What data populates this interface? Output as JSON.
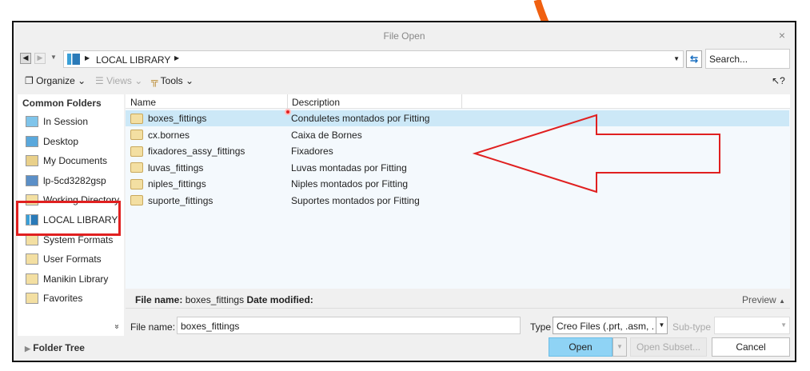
{
  "window": {
    "title": "File Open",
    "close": "×"
  },
  "address": {
    "path": "LOCAL LIBRARY",
    "search_placeholder": "Search..."
  },
  "toolbar": {
    "organize": "Organize",
    "views": "Views",
    "tools": "Tools",
    "help": "?"
  },
  "sidebar": {
    "heading": "Common Folders",
    "items": [
      {
        "label": "In Session"
      },
      {
        "label": "Desktop"
      },
      {
        "label": "My Documents"
      },
      {
        "label": "lp-5cd3282gsp"
      },
      {
        "label": "Working Directory"
      },
      {
        "label": "LOCAL LIBRARY"
      },
      {
        "label": "System Formats"
      },
      {
        "label": "User Formats"
      },
      {
        "label": "Manikin Library"
      },
      {
        "label": "Favorites"
      }
    ],
    "more": "»",
    "folder_tree": "Folder Tree"
  },
  "list": {
    "columns": [
      "Name",
      "Description"
    ],
    "rows": [
      {
        "name": "boxes_fittings",
        "description": "Conduletes montados por Fitting",
        "selected": true
      },
      {
        "name": "cx.bornes",
        "description": "Caixa de Bornes"
      },
      {
        "name": "fixadores_assy_fittings",
        "description": "Fixadores"
      },
      {
        "name": "luvas_fittings",
        "description": "Luvas montadas por Fitting"
      },
      {
        "name": "niples_fittings",
        "description": "Niples montados por Fitting"
      },
      {
        "name": "suporte_fittings",
        "description": "Suportes montados por Fitting"
      }
    ]
  },
  "info": {
    "file_name_label": "File name:",
    "file_name": "boxes_fittings",
    "date_label": "Date modified:",
    "preview": "Preview"
  },
  "footer": {
    "file_name_label": "File name:",
    "file_name_value": "boxes_fittings",
    "type_label": "Type",
    "type_value": "Creo Files (.prt, .asm, .",
    "subtype_label": "Sub-type",
    "open": "Open",
    "open_subset": "Open Subset...",
    "cancel": "Cancel"
  },
  "colors": {
    "selection": "#cce8f7",
    "open_button": "#8fd3f5",
    "annotation_red": "#e02020",
    "annotation_orange": "#f06010"
  }
}
